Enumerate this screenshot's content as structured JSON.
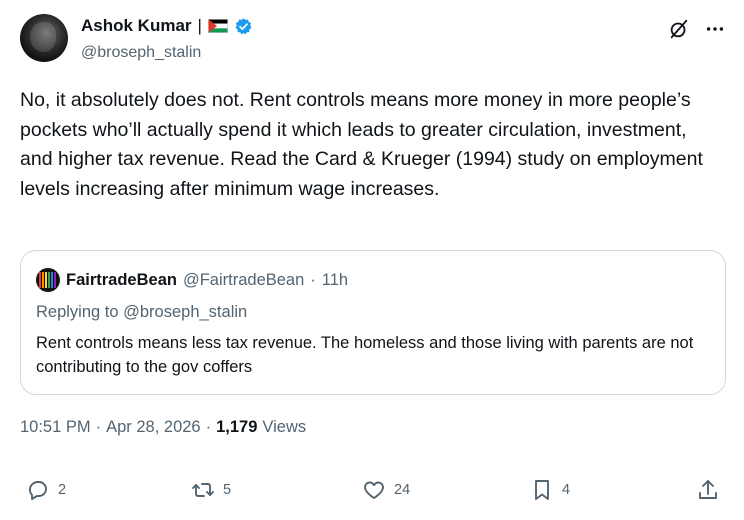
{
  "author": {
    "display_name": "Ashok Kumar",
    "separator": "|",
    "handle": "@broseph_stalin"
  },
  "top_actions": {
    "grok_icon": "grok-icon",
    "more_icon": "more-icon"
  },
  "tweet": {
    "text": "No, it absolutely does not. Rent controls means more money in more people’s pockets who’ll actually spend it which leads to greater circulation, investment, and higher tax revenue. Read the Card & Krueger (1994) study on employment levels increasing after minimum wage increases."
  },
  "quote": {
    "name": "FairtradeBean",
    "handle": "@FairtradeBean",
    "dot": "·",
    "time": "11h",
    "replying_to": "Replying to @broseph_stalin",
    "text": "Rent controls means less tax revenue. The homeless and those living with parents are not contributing to the gov coffers"
  },
  "meta": {
    "time": "10:51 PM",
    "dot1": "·",
    "date": "Apr 28, 2026",
    "dot2": "·",
    "views_count": "1,179",
    "views_label": "Views"
  },
  "actions": {
    "replies": "2",
    "retweets": "5",
    "likes": "24",
    "bookmarks": "4"
  },
  "colors": {
    "text": "#0f1419",
    "secondary": "#536471",
    "verified": "#1d9bf0",
    "border": "#cfd9de"
  }
}
